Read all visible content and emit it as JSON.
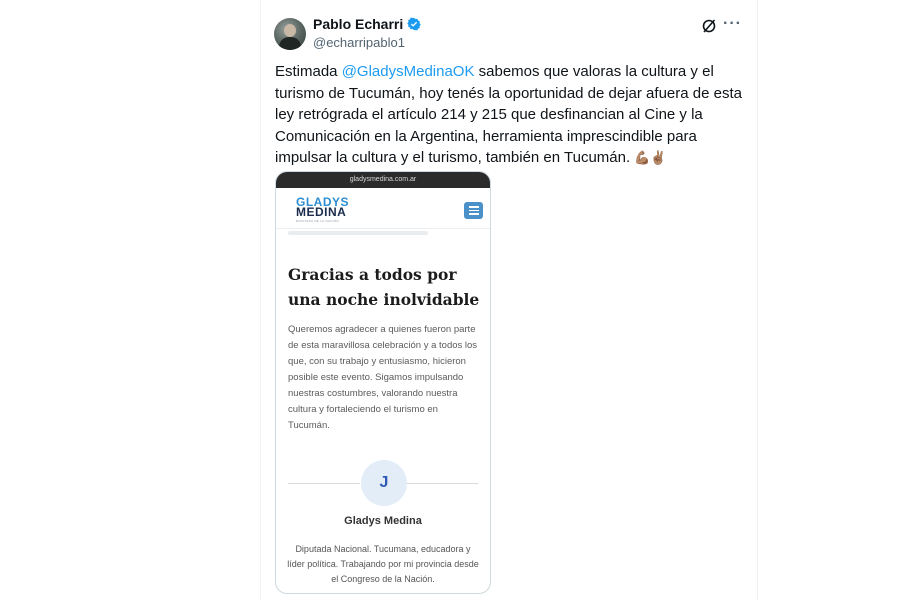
{
  "tweet": {
    "author_name": "Pablo Echarri",
    "author_handle": "@echarripablo1",
    "text_before": "Estimada ",
    "mention": "@GladysMedinaOK",
    "text_after": " sabemos que valoras la cultura y el turismo de Tucumán, hoy tenés la oportunidad de dejar afuera de esta ley retrógrada el artículo 214 y 215 que desfinancian al Cine y la Comunicación en la Argentina, herramienta imprescindible para impulsar la cultura y el turismo, también en Tucumán.",
    "emojis": "💪🏽✌🏽",
    "more_label": "···",
    "icons": {
      "verified": "verified-badge-icon",
      "grok": "grok-icon",
      "more": "more-options-icon"
    },
    "colors": {
      "link": "#1d9bf0",
      "text": "#0f1419",
      "muted": "#536471"
    }
  },
  "embedded_image": {
    "url": "gladysmedina.com.ar",
    "logo_line1": "GLADYS",
    "logo_line2": "MEDINA",
    "logo_tagline": "DIPUTADA DE LA NACIÓN",
    "article_title": "Gracias a todos por una noche inolvidable",
    "article_body": "Queremos agradecer a quienes fueron parte de esta maravillosa celebración y a todos los que, con su trabajo y entusiasmo, hicieron posible este evento. Sigamos impulsando nuestras costumbres, valorando nuestra cultura y fortaleciendo el turismo en Tucumán.",
    "author_initial": "J",
    "author_name": "Gladys Medina",
    "author_bio": "Diputada Nacional. Tucumana, educadora y líder política. Trabajando por mi provincia desde el Congreso de la Nación."
  }
}
